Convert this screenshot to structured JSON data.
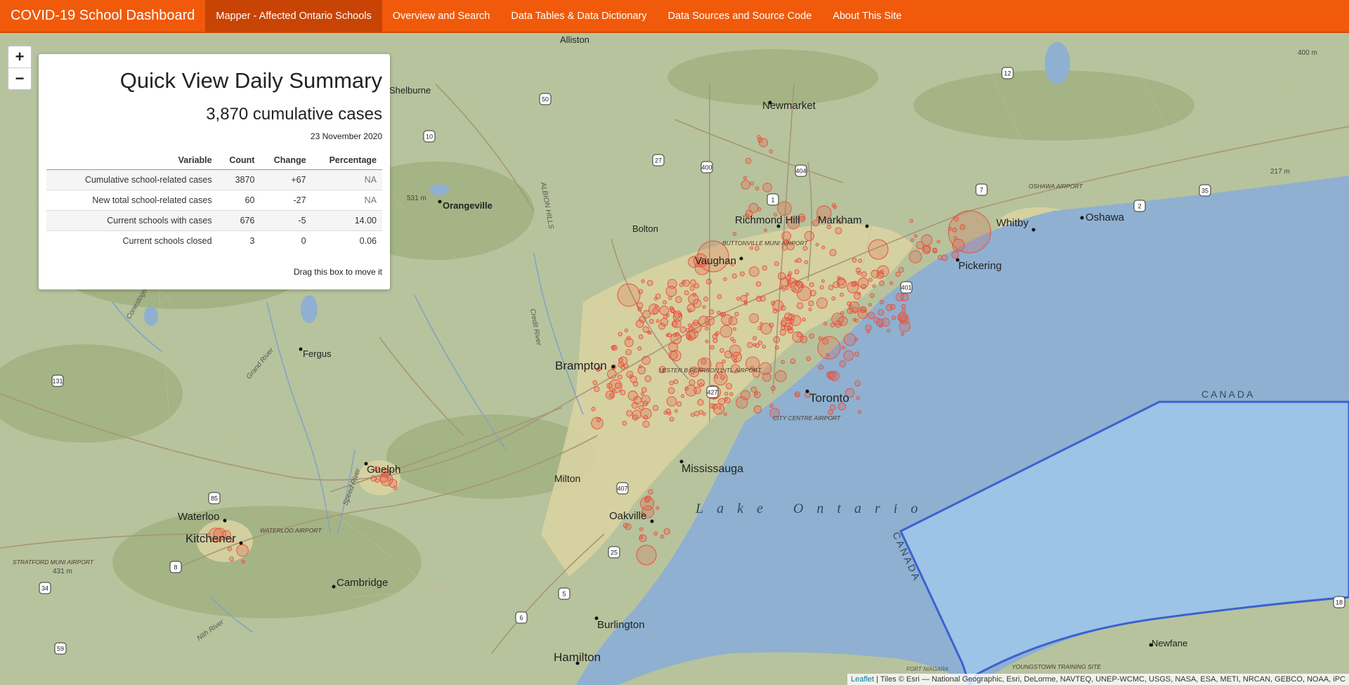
{
  "nav": {
    "brand": "COVID-19 School Dashboard",
    "items": [
      "Mapper - Affected Ontario Schools",
      "Overview and Search",
      "Data Tables & Data Dictionary",
      "Data Sources and Source Code",
      "About This Site"
    ],
    "active": 0
  },
  "zoom": {
    "in_label": "+",
    "out_label": "−"
  },
  "summary": {
    "title": "Quick View Daily Summary",
    "cumulative": "3,870 cumulative cases",
    "date": "23 November 2020",
    "columns": [
      "Variable",
      "Count",
      "Change",
      "Percentage"
    ],
    "rows": [
      [
        "Cumulative school-related cases",
        "3870",
        "+67",
        "NA"
      ],
      [
        "New total school-related cases",
        "60",
        "-27",
        "NA"
      ],
      [
        "Current schools with cases",
        "676",
        "-5",
        "14.00"
      ],
      [
        "Current schools closed",
        "3",
        "0",
        "0.06"
      ]
    ],
    "drag_hint": "Drag this box to move it"
  },
  "map": {
    "places": [
      "Alliston",
      "Shelburne",
      "Newmarket",
      "Orangeville",
      "Bolton",
      "Richmond Hill",
      "Markham",
      "Vaughan",
      "Whitby",
      "Oshawa",
      "Pickering",
      "Fergus",
      "Brampton",
      "Toronto",
      "Mississauga",
      "Guelph",
      "Milton",
      "Waterloo",
      "Kitchener",
      "Oakville",
      "Cambridge",
      "Burlington",
      "Hamilton",
      "Newfane"
    ],
    "water_label": "Lake Ontario",
    "border_label": "CANADA",
    "airports": [
      "BUTTONVILLE MUNI AIRPORT",
      "LESTER B PEARSON INTL AIRPORT",
      "CITY CENTRE AIRPORT",
      "OSHAWA AIRPORT",
      "WATERLOO AIRPORT",
      "STRATFORD MUNI AIRPORT",
      "YOUNGSTOWN TRAINING SITE"
    ],
    "route_shields": [
      "50",
      "10",
      "27",
      "400",
      "404",
      "1",
      "12",
      "7",
      "2",
      "401",
      "35",
      "131",
      "85",
      "8",
      "34",
      "59",
      "6",
      "5",
      "25",
      "407",
      "427",
      "18"
    ],
    "elevation_labels": [
      "400 m",
      "217 m",
      "531 m",
      "431 m"
    ],
    "features": [
      "ALBION HILLS",
      "Credit River",
      "Grand River",
      "Speed River",
      "Nith River",
      "Conestogo",
      "FORT NIAGARA"
    ],
    "colors": {
      "water": "#8fb0d0",
      "land": "#b8c4a0",
      "case_marker": "#e8503c",
      "lake_polygon": "#9dc3e6",
      "border": "#3a62d0"
    }
  },
  "attribution": {
    "leaflet": "Leaflet",
    "text": " | Tiles © Esri — National Geographic, Esri, DeLorme, NAVTEQ, UNEP-WCMC, USGS, NASA, ESA, METI, NRCAN, GEBCO, NOAA, iPC"
  }
}
